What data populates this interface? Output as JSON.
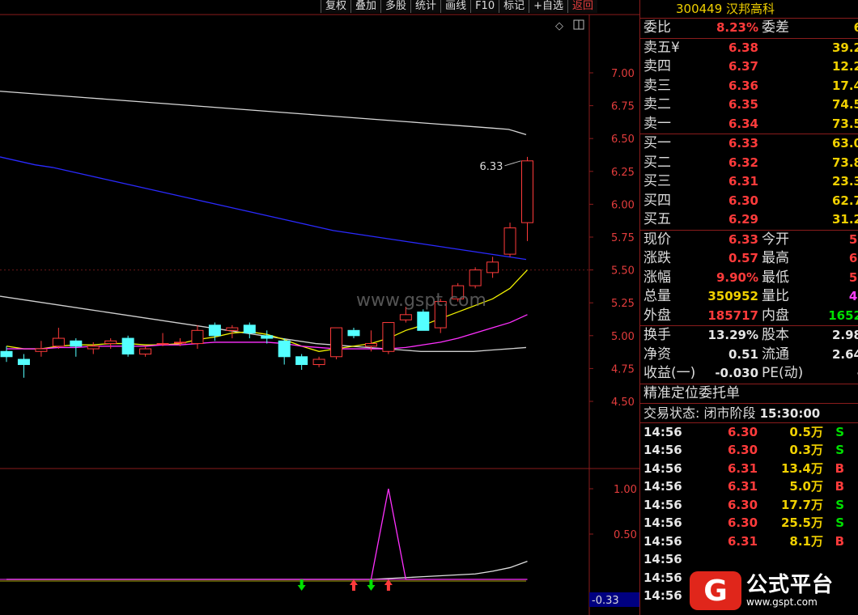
{
  "toolbar": [
    "复权",
    "叠加",
    "多股",
    "统计",
    "画线",
    "F10",
    "标记",
    "+自选",
    "返回"
  ],
  "chart": {
    "watermark": "www.gspt.com",
    "last_price_label": "6.33",
    "price_axis": [
      "7.00",
      "6.75",
      "6.50",
      "6.25",
      "6.00",
      "5.75",
      "5.50",
      "5.25",
      "5.00",
      "4.75",
      "4.50"
    ],
    "indicator_axis": [
      "1.00",
      "0.50"
    ],
    "indicator_readout": "-0.33",
    "colors": {
      "up": "#ff3b3b",
      "down": "#54ffff",
      "ma_white": "#d8d8d8",
      "ma_yellow": "#f0f000",
      "ma_magenta": "#ff30ff",
      "ma_blue": "#2a2aff",
      "grid": "#8a1c1c"
    }
  },
  "chart_data": {
    "type": "candlestick",
    "price_ylim": [
      4.5,
      7.0
    ],
    "last_price": 6.33,
    "candles": [
      {
        "o": 4.88,
        "h": 4.92,
        "l": 4.8,
        "c": 4.84
      },
      {
        "o": 4.82,
        "h": 4.86,
        "l": 4.68,
        "c": 4.78
      },
      {
        "o": 4.88,
        "h": 4.96,
        "l": 4.84,
        "c": 4.9
      },
      {
        "o": 4.92,
        "h": 5.06,
        "l": 4.9,
        "c": 4.98
      },
      {
        "o": 4.96,
        "h": 4.98,
        "l": 4.84,
        "c": 4.92
      },
      {
        "o": 4.9,
        "h": 4.95,
        "l": 4.86,
        "c": 4.92
      },
      {
        "o": 4.94,
        "h": 4.98,
        "l": 4.9,
        "c": 4.96
      },
      {
        "o": 4.98,
        "h": 5.0,
        "l": 4.84,
        "c": 4.86
      },
      {
        "o": 4.86,
        "h": 4.92,
        "l": 4.84,
        "c": 4.9
      },
      {
        "o": 4.94,
        "h": 5.02,
        "l": 4.92,
        "c": 4.94
      },
      {
        "o": 4.95,
        "h": 4.98,
        "l": 4.92,
        "c": 4.95
      },
      {
        "o": 4.94,
        "h": 5.08,
        "l": 4.9,
        "c": 5.04
      },
      {
        "o": 5.08,
        "h": 5.1,
        "l": 4.96,
        "c": 5.0
      },
      {
        "o": 5.04,
        "h": 5.08,
        "l": 4.98,
        "c": 5.06
      },
      {
        "o": 5.08,
        "h": 5.1,
        "l": 4.98,
        "c": 5.02
      },
      {
        "o": 5.0,
        "h": 5.04,
        "l": 4.94,
        "c": 4.98
      },
      {
        "o": 4.96,
        "h": 4.98,
        "l": 4.78,
        "c": 4.84
      },
      {
        "o": 4.84,
        "h": 4.86,
        "l": 4.74,
        "c": 4.78
      },
      {
        "o": 4.78,
        "h": 4.84,
        "l": 4.76,
        "c": 4.82
      },
      {
        "o": 4.84,
        "h": 5.06,
        "l": 4.82,
        "c": 5.06
      },
      {
        "o": 5.04,
        "h": 5.06,
        "l": 4.98,
        "c": 5.0
      },
      {
        "o": 4.92,
        "h": 5.04,
        "l": 4.88,
        "c": 4.94
      },
      {
        "o": 4.88,
        "h": 5.1,
        "l": 4.86,
        "c": 5.1
      },
      {
        "o": 5.12,
        "h": 5.22,
        "l": 5.1,
        "c": 5.16
      },
      {
        "o": 5.18,
        "h": 5.2,
        "l": 5.04,
        "c": 5.04
      },
      {
        "o": 5.06,
        "h": 5.28,
        "l": 5.02,
        "c": 5.26
      },
      {
        "o": 5.28,
        "h": 5.4,
        "l": 5.26,
        "c": 5.38
      },
      {
        "o": 5.38,
        "h": 5.52,
        "l": 5.36,
        "c": 5.5
      },
      {
        "o": 5.48,
        "h": 5.6,
        "l": 5.44,
        "c": 5.56
      },
      {
        "o": 5.62,
        "h": 5.86,
        "l": 5.6,
        "c": 5.82
      },
      {
        "o": 5.86,
        "h": 6.36,
        "l": 5.72,
        "c": 6.33
      }
    ],
    "ma_white_long": [
      6.86,
      6.85,
      6.84,
      6.83,
      6.82,
      6.81,
      6.8,
      6.79,
      6.78,
      6.77,
      6.76,
      6.75,
      6.74,
      6.73,
      6.72,
      6.71,
      6.7,
      6.69,
      6.68,
      6.67,
      6.66,
      6.65,
      6.64,
      6.63,
      6.62,
      6.61,
      6.6,
      6.59,
      6.58,
      6.57,
      6.53
    ],
    "ma_blue": [
      6.36,
      6.33,
      6.3,
      6.28,
      6.25,
      6.22,
      6.19,
      6.16,
      6.13,
      6.1,
      6.07,
      6.04,
      6.01,
      5.98,
      5.95,
      5.92,
      5.89,
      5.86,
      5.83,
      5.8,
      5.78,
      5.76,
      5.74,
      5.72,
      5.7,
      5.68,
      5.66,
      5.64,
      5.62,
      5.6,
      5.58
    ],
    "ma_white_mid": [
      5.3,
      5.28,
      5.26,
      5.24,
      5.22,
      5.2,
      5.18,
      5.16,
      5.14,
      5.12,
      5.1,
      5.08,
      5.06,
      5.04,
      5.02,
      5.0,
      4.98,
      4.96,
      4.94,
      4.93,
      4.92,
      4.91,
      4.9,
      4.89,
      4.88,
      4.88,
      4.88,
      4.88,
      4.89,
      4.9,
      4.91
    ],
    "ma_yellow": [
      4.92,
      4.9,
      4.9,
      4.92,
      4.93,
      4.93,
      4.94,
      4.94,
      4.93,
      4.93,
      4.94,
      4.97,
      4.99,
      5.02,
      5.03,
      5.01,
      4.97,
      4.92,
      4.88,
      4.9,
      4.92,
      4.94,
      4.98,
      5.04,
      5.08,
      5.13,
      5.18,
      5.23,
      5.28,
      5.36,
      5.5
    ],
    "ma_magenta": [
      4.9,
      4.9,
      4.9,
      4.91,
      4.91,
      4.92,
      4.92,
      4.92,
      4.92,
      4.93,
      4.93,
      4.94,
      4.95,
      4.95,
      4.95,
      4.95,
      4.94,
      4.92,
      4.91,
      4.9,
      4.9,
      4.9,
      4.9,
      4.91,
      4.93,
      4.95,
      4.98,
      5.02,
      5.06,
      5.1,
      5.16
    ],
    "indicator_ylim": [
      -0.2,
      1.2
    ],
    "indicator_magenta": [
      0,
      0,
      0,
      0,
      0,
      0,
      0,
      0,
      0,
      0,
      0,
      0,
      0,
      0,
      0,
      0,
      0,
      0,
      0,
      0,
      0,
      0,
      1.0,
      0,
      0,
      0,
      0,
      0,
      0,
      0,
      0
    ],
    "indicator_white": [
      0,
      0,
      0,
      0,
      0,
      0,
      0,
      0,
      0,
      0,
      0,
      0,
      0,
      0,
      0,
      0,
      0,
      0,
      0,
      0,
      0,
      0,
      0.01,
      0.02,
      0.03,
      0.04,
      0.05,
      0.06,
      0.09,
      0.13,
      0.2
    ],
    "arrows": [
      {
        "i": 17,
        "dir": "down"
      },
      {
        "i": 20,
        "dir": "up"
      },
      {
        "i": 21,
        "dir": "down"
      },
      {
        "i": 22,
        "dir": "up"
      }
    ]
  },
  "stock": {
    "code": "300449",
    "name": "汉邦高科"
  },
  "order_ratio": {
    "label": "委比",
    "value": "8.23%",
    "label2": "委差",
    "value2": "6"
  },
  "asks": [
    {
      "label": "卖五¥",
      "price": "6.38",
      "vol": "39.2"
    },
    {
      "label": "卖四",
      "price": "6.37",
      "vol": "12.2"
    },
    {
      "label": "卖三",
      "price": "6.36",
      "vol": "17.4"
    },
    {
      "label": "卖二",
      "price": "6.35",
      "vol": "74.5"
    },
    {
      "label": "卖一",
      "price": "6.34",
      "vol": "73.5"
    }
  ],
  "bids": [
    {
      "label": "买一",
      "price": "6.33",
      "vol": "63.0"
    },
    {
      "label": "买二",
      "price": "6.32",
      "vol": "73.8"
    },
    {
      "label": "买三",
      "price": "6.31",
      "vol": "23.3"
    },
    {
      "label": "买四",
      "price": "6.30",
      "vol": "62.7"
    },
    {
      "label": "买五",
      "price": "6.29",
      "vol": "31.2"
    }
  ],
  "quote": [
    {
      "l1": "现价",
      "v1": "6.33",
      "l2": "今开",
      "v2": "5."
    },
    {
      "l1": "涨跌",
      "v1": "0.57",
      "l2": "最高",
      "v2": "6."
    },
    {
      "l1": "涨幅",
      "v1": "9.90%",
      "l2": "最低",
      "v2": "5."
    },
    {
      "l1": "总量",
      "v1": "350952",
      "l2": "量比",
      "v2": "4."
    },
    {
      "l1": "外盘",
      "v1": "185717",
      "l2": "内盘",
      "v2": "1652"
    }
  ],
  "fundamentals": [
    {
      "l1": "换手",
      "v1": "13.29%",
      "l2": "股本",
      "v2": "2.98"
    },
    {
      "l1": "净资",
      "v1": "0.51",
      "l2": "流通",
      "v2": "2.64"
    },
    {
      "l1": "收益(一)",
      "v1": "-0.030",
      "l2": "PE(动)",
      "v2": "-"
    }
  ],
  "order_section_title": "精准定位委托单",
  "status": {
    "label": "交易状态: 闭市阶段",
    "time": "15:30:00"
  },
  "trades": [
    {
      "time": "14:56",
      "price": "6.30",
      "vol": "0.5万",
      "side": "S"
    },
    {
      "time": "14:56",
      "price": "6.30",
      "vol": "0.3万",
      "side": "S"
    },
    {
      "time": "14:56",
      "price": "6.31",
      "vol": "13.4万",
      "side": "B"
    },
    {
      "time": "14:56",
      "price": "6.31",
      "vol": "5.0万",
      "side": "B"
    },
    {
      "time": "14:56",
      "price": "6.30",
      "vol": "17.7万",
      "side": "S"
    },
    {
      "time": "14:56",
      "price": "6.30",
      "vol": "25.5万",
      "side": "S"
    },
    {
      "time": "14:56",
      "price": "6.31",
      "vol": "8.1万",
      "side": "B"
    },
    {
      "time": "14:56",
      "price": "",
      "vol": "",
      "side": ""
    },
    {
      "time": "14:56",
      "price": "",
      "vol": "",
      "side": ""
    },
    {
      "time": "14:56",
      "price": "",
      "vol": "",
      "side": ""
    }
  ],
  "logo": {
    "badge": "G",
    "title": "公式平台",
    "url": "www.gspt.com"
  }
}
